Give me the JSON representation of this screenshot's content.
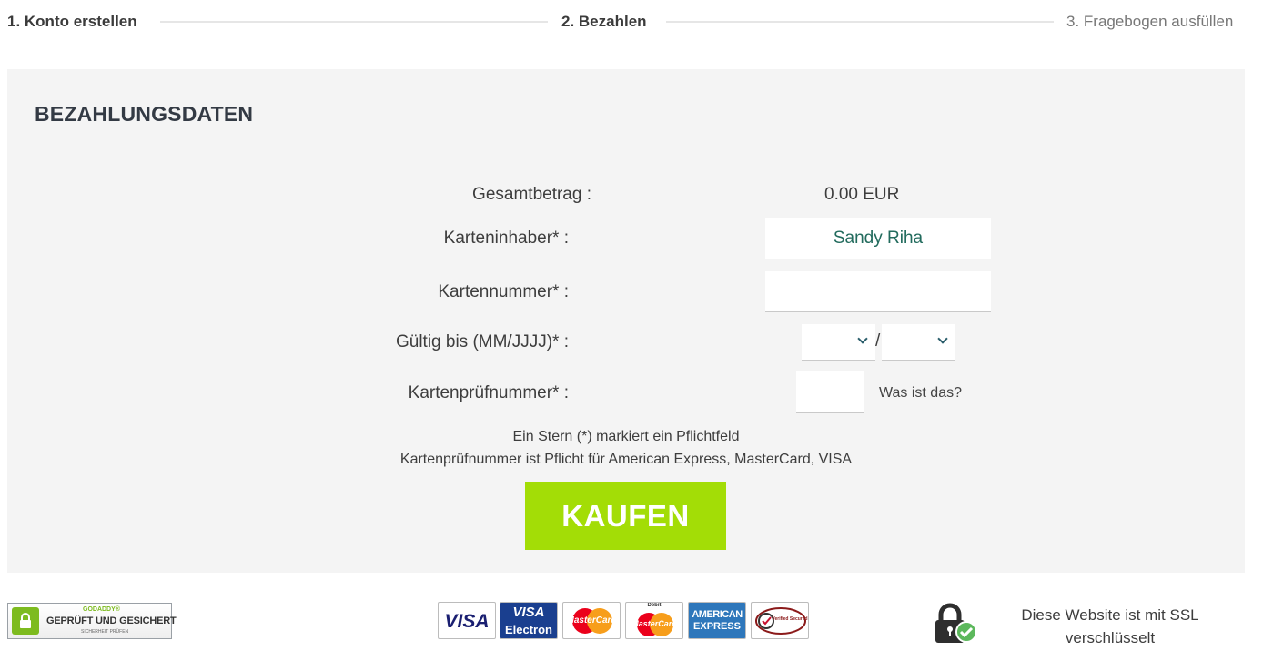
{
  "stepper": {
    "steps": [
      {
        "label": "1. Konto erstellen",
        "state": "done"
      },
      {
        "label": "2. Bezahlen",
        "state": "active"
      },
      {
        "label": "3. Fragebogen ausfüllen",
        "state": "todo"
      }
    ]
  },
  "payment": {
    "title": "BEZAHLUNGSDATEN",
    "total_label": "Gesamtbetrag :",
    "total_value": "0.00 EUR",
    "holder_label": "Karteninhaber* :",
    "holder_value": "Sandy Riha",
    "number_label": "Kartennummer* :",
    "number_value": "",
    "expiry_label": "Gültig bis (MM/JJJJ)* :",
    "expiry_separator": "/",
    "cvc_label": "Kartenprüfnummer* :",
    "cvc_value": "",
    "cvc_help": "Was ist das?",
    "note_required": "Ein Stern (*) markiert ein Pflichtfeld",
    "note_cvc": "Kartenprüfnummer ist Pflicht für American Express, MasterCard, VISA",
    "buy_label": "KAUFEN"
  },
  "footer": {
    "godaddy_brand": "GODADDY®",
    "godaddy_main": "GEPRÜFT UND GESICHERT",
    "godaddy_sub": "SICHERHEIT PRÜFEN",
    "cards": {
      "visa": "VISA",
      "visa_electron_top": "VISA",
      "visa_electron_bottom": "Electron",
      "mastercard": "MasterCard",
      "debit_top": "Debit",
      "debit": "MasterCard",
      "amex_top": "AMERICAN",
      "amex_bottom": "EXPRESS",
      "verified": "Verified Secured"
    },
    "ssl_text": "Diese Website ist mit SSL verschlüsselt"
  },
  "colors": {
    "buy_button": "#a3dd06",
    "panel_bg": "#f4f4f4",
    "holder_text": "#226b5d"
  }
}
